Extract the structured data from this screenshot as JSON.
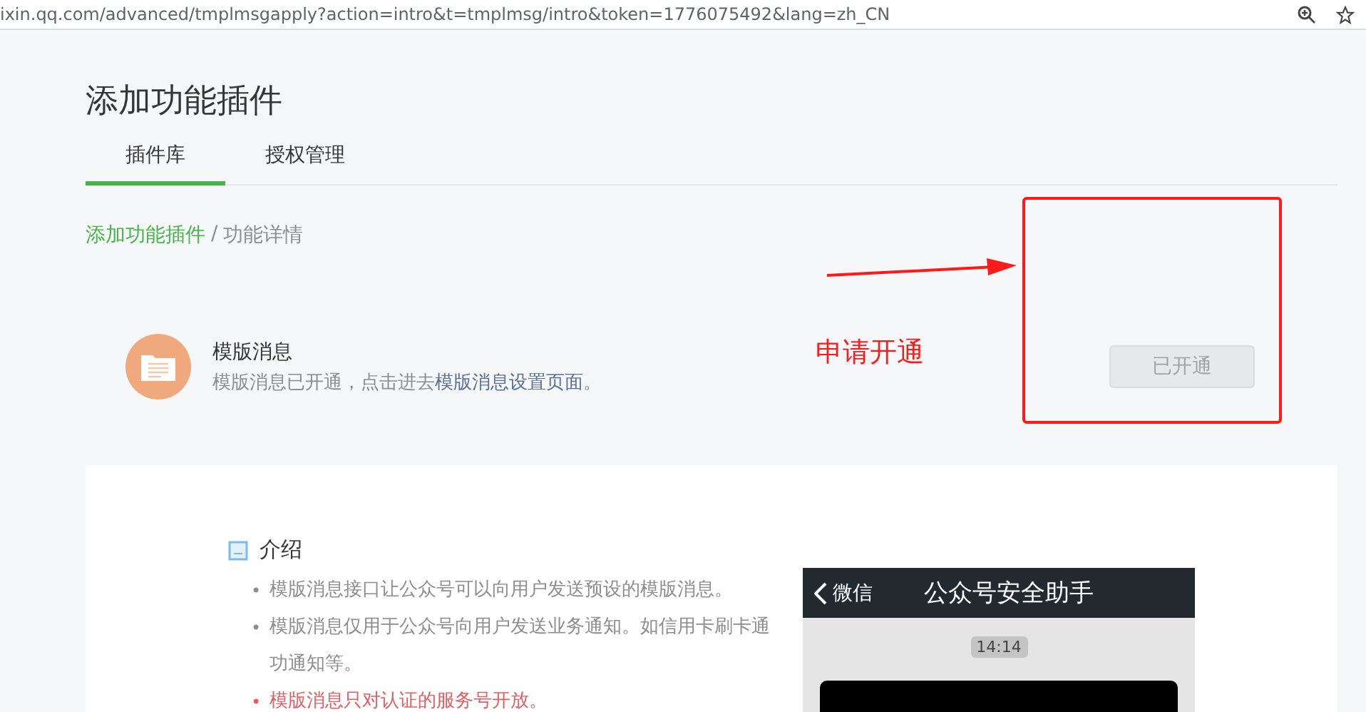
{
  "address_bar": {
    "url": "ixin.qq.com/advanced/tmplmsgapply?action=intro&t=tmplmsg/intro&token=1776075492&lang=zh_CN"
  },
  "page_title": "添加功能插件",
  "tabs": [
    {
      "label": "插件库",
      "selected": true
    },
    {
      "label": "授权管理",
      "selected": false
    }
  ],
  "breadcrumb": {
    "link": "添加功能插件",
    "separator": "/",
    "current": "功能详情"
  },
  "plugin": {
    "name": "模版消息",
    "description": "模版消息已开通，点击进去",
    "description_link": "模版消息设置页面",
    "description_end": "。",
    "button": {
      "label": "已开通",
      "disabled": true
    }
  },
  "annotation": {
    "label": "申请开通"
  },
  "intro": {
    "heading": "介绍",
    "items": [
      {
        "kind": "normal",
        "bullet": "•",
        "lines": [
          "模版消息接口让公众号可以向用户发送预设的模版消息。"
        ]
      },
      {
        "kind": "normal",
        "bullet": "•",
        "lines": [
          "模版消息仅用于公众号向用户发送业务通知。如信用卡刷卡通",
          "功通知等。"
        ]
      },
      {
        "kind": "warning",
        "bullet": "•",
        "lines": [
          "模版消息只对认证的服务号开放。"
        ]
      }
    ]
  },
  "phone_preview": {
    "back": "微信",
    "title": "公众号安全助手",
    "time": "14:14"
  }
}
